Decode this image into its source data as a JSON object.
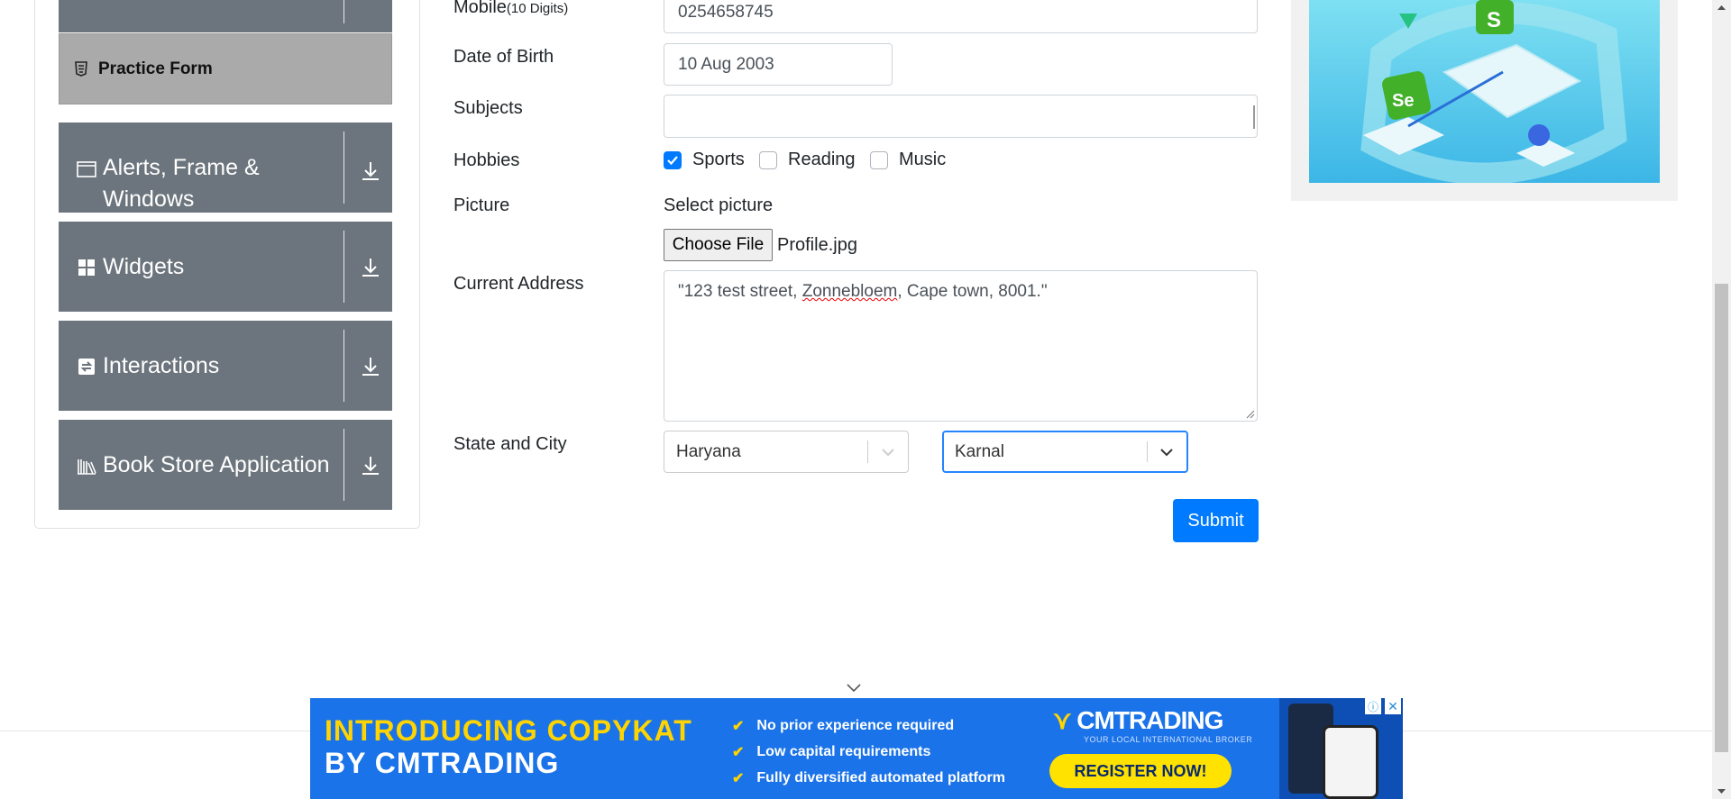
{
  "sidebar": {
    "practice_form_label": "Practice Form",
    "groups": [
      {
        "label_line1": "Alerts, Frame &",
        "label_line2": "Windows",
        "icon": "window-icon"
      },
      {
        "label": "Widgets",
        "icon": "widgets-icon"
      },
      {
        "label": "Interactions",
        "icon": "interactions-icon"
      },
      {
        "label": "Book Store Application",
        "icon": "books-icon"
      }
    ]
  },
  "form": {
    "mobile_label": "Mobile",
    "mobile_hint": "(10 Digits)",
    "mobile_value": "0254658745",
    "dob_label": "Date of Birth",
    "dob_value": "10 Aug 2003",
    "subjects_label": "Subjects",
    "subjects_value": "",
    "hobbies_label": "Hobbies",
    "hobbies": [
      {
        "label": "Sports",
        "checked": true
      },
      {
        "label": "Reading",
        "checked": false
      },
      {
        "label": "Music",
        "checked": false
      }
    ],
    "picture_label": "Picture",
    "select_picture_label": "Select picture",
    "choose_file_label": "Choose File",
    "file_name": "Profile.jpg",
    "address_label": "Current Address",
    "address_prefix": "\"123 test street, ",
    "address_misspelled": "Zonnebloem",
    "address_suffix": ", Cape town, 8001.\"",
    "state_city_label": "State and City",
    "state_value": "Haryana",
    "city_value": "Karnal",
    "submit_label": "Submit"
  },
  "ad": {
    "headline1": "INTRODUCING COPYKAT",
    "headline2": "BY CMTRADING",
    "bullets": [
      "No prior experience required",
      "Low capital requirements",
      "Fully diversified automated platform"
    ],
    "brand": "CMTRADING",
    "tagline": "YOUR LOCAL INTERNATIONAL BROKER",
    "cta": "REGISTER NOW!"
  },
  "colors": {
    "sidebar_group_bg": "#6c757d",
    "practice_item_bg": "#aaaaaa",
    "primary": "#007bff",
    "focus_border": "#2684ff",
    "ad_bg": "#1a73e8",
    "ad_accent": "#ffd400"
  }
}
